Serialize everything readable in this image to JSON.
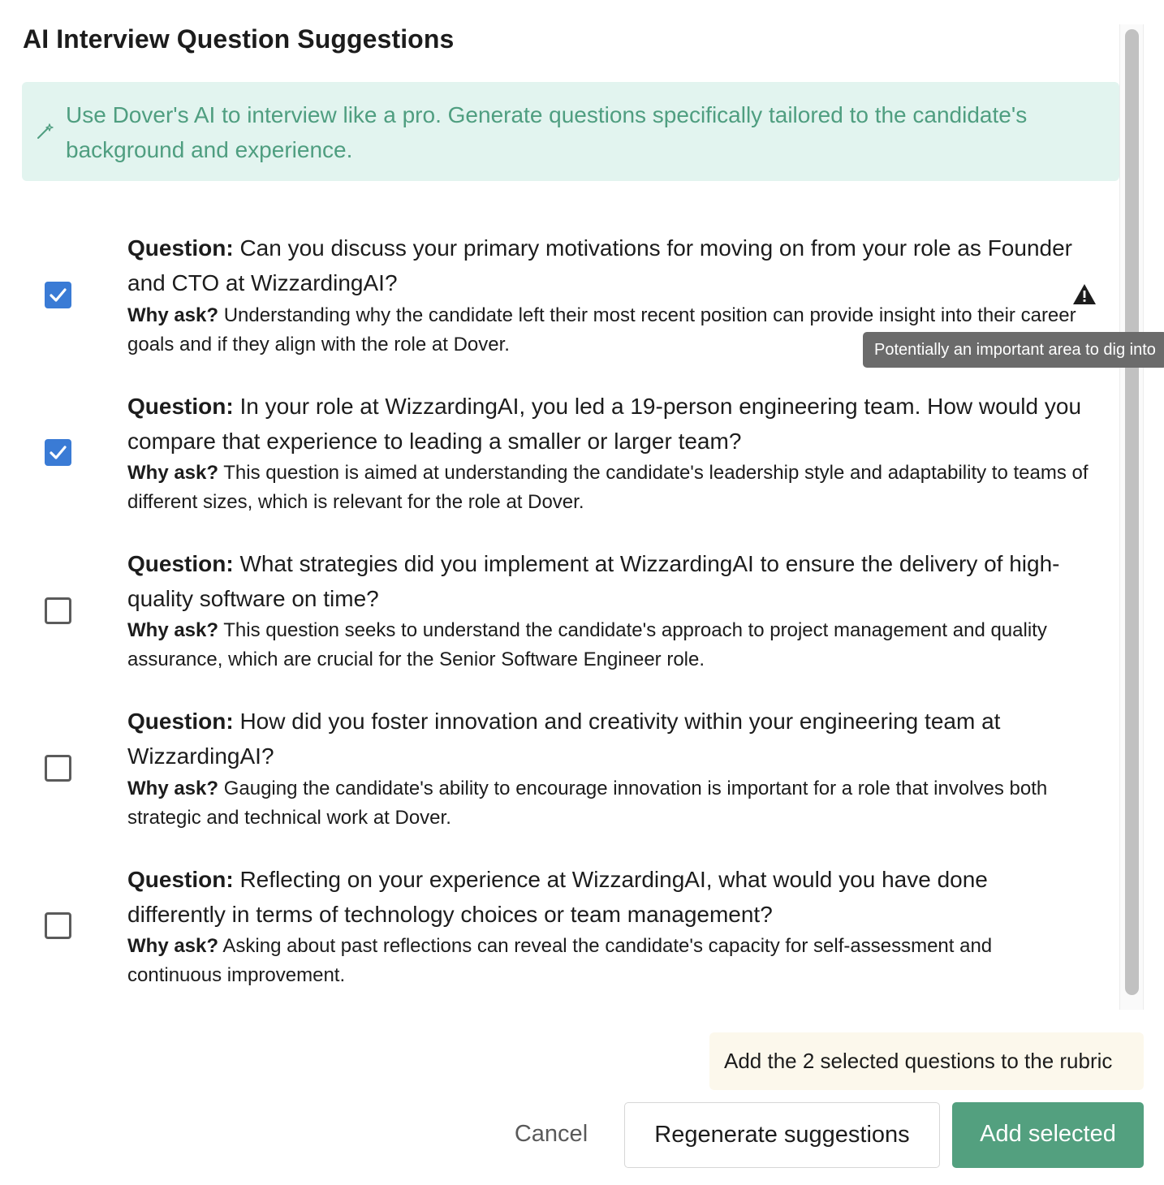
{
  "dialog": {
    "title": "AI Interview Question Suggestions"
  },
  "banner": {
    "icon": "magic-wand-icon",
    "text": "Use Dover's AI to interview like a pro. Generate questions specifically tailored to the candidate's background and experience."
  },
  "labels": {
    "question": "Question:",
    "why": "Why ask?"
  },
  "questions": [
    {
      "checked": true,
      "question": "Can you discuss your primary motivations for moving on from your role as Founder and CTO at WizzardingAI?",
      "why": "Understanding why the candidate left their most recent position can provide insight into their career goals and if they align with the role at Dover.",
      "flag_icon": "warning-triangle-icon",
      "tooltip": "Potentially an important area to dig into"
    },
    {
      "checked": true,
      "question": "In your role at WizzardingAI, you led a 19-person engineering team. How would you compare that experience to leading a smaller or larger team?",
      "why": "This question is aimed at understanding the candidate's leadership style and adaptability to teams of different sizes, which is relevant for the role at Dover."
    },
    {
      "checked": false,
      "question": "What strategies did you implement at WizzardingAI to ensure the delivery of high-quality software on time?",
      "why": "This question seeks to understand the candidate's approach to project management and quality assurance, which are crucial for the Senior Software Engineer role."
    },
    {
      "checked": false,
      "question": "How did you foster innovation and creativity within your engineering team at WizzardingAI?",
      "why": "Gauging the candidate's ability to encourage innovation is important for a role that involves both strategic and technical work at Dover."
    },
    {
      "checked": false,
      "question": "Reflecting on your experience at WizzardingAI, what would you have done differently in terms of technology choices or team management?",
      "why": "Asking about past reflections can reveal the candidate's capacity for self-assessment and continuous improvement."
    }
  ],
  "footer": {
    "note": "Add the 2 selected questions to the rubric",
    "cancel_label": "Cancel",
    "regenerate_label": "Regenerate suggestions",
    "add_label": "Add selected"
  },
  "colors": {
    "accent_green": "#53a07f",
    "banner_bg": "#e2f4ef",
    "banner_text": "#4f9e80",
    "checkbox_blue": "#3a7bd5",
    "note_bg": "#fcf8ec"
  }
}
